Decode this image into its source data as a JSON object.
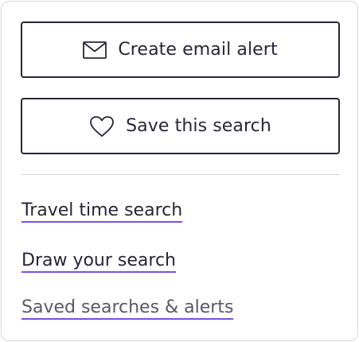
{
  "actions": {
    "email_alert": {
      "label": "Create email alert",
      "icon": "envelope-icon"
    },
    "save_search": {
      "label": "Save this search",
      "icon": "heart-icon"
    }
  },
  "links": {
    "travel_time": "Travel time search",
    "draw": "Draw your search",
    "saved": "Saved searches & alerts"
  },
  "colors": {
    "text": "#262637",
    "link_underline": "#7b4fe0",
    "border": "#d8d8dc",
    "muted_text": "#5a5866"
  }
}
